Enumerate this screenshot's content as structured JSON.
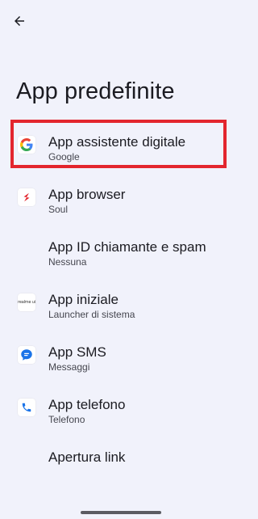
{
  "header": {
    "title": "App predefinite"
  },
  "items": [
    {
      "title": "App assistente digitale",
      "subtitle": "Google",
      "icon": "google-icon"
    },
    {
      "title": "App browser",
      "subtitle": "Soul",
      "icon": "soul-browser-icon"
    },
    {
      "title": "App ID chiamante e spam",
      "subtitle": "Nessuna",
      "icon": ""
    },
    {
      "title": "App iniziale",
      "subtitle": "Launcher di sistema",
      "icon": "realme-launcher-icon",
      "icon_text": "realme ui"
    },
    {
      "title": "App SMS",
      "subtitle": "Messaggi",
      "icon": "messages-icon"
    },
    {
      "title": "App telefono",
      "subtitle": "Telefono",
      "icon": "phone-icon"
    },
    {
      "title": "Apertura link",
      "subtitle": "",
      "icon": ""
    }
  ],
  "colors": {
    "background": "#f1f2fb",
    "highlight": "#e3262e",
    "google_blue": "#4285f4",
    "google_red": "#ea4335",
    "google_yellow": "#fbbc05",
    "google_green": "#34a853",
    "messages_blue": "#1a73e8",
    "soul_red": "#e3262e"
  }
}
